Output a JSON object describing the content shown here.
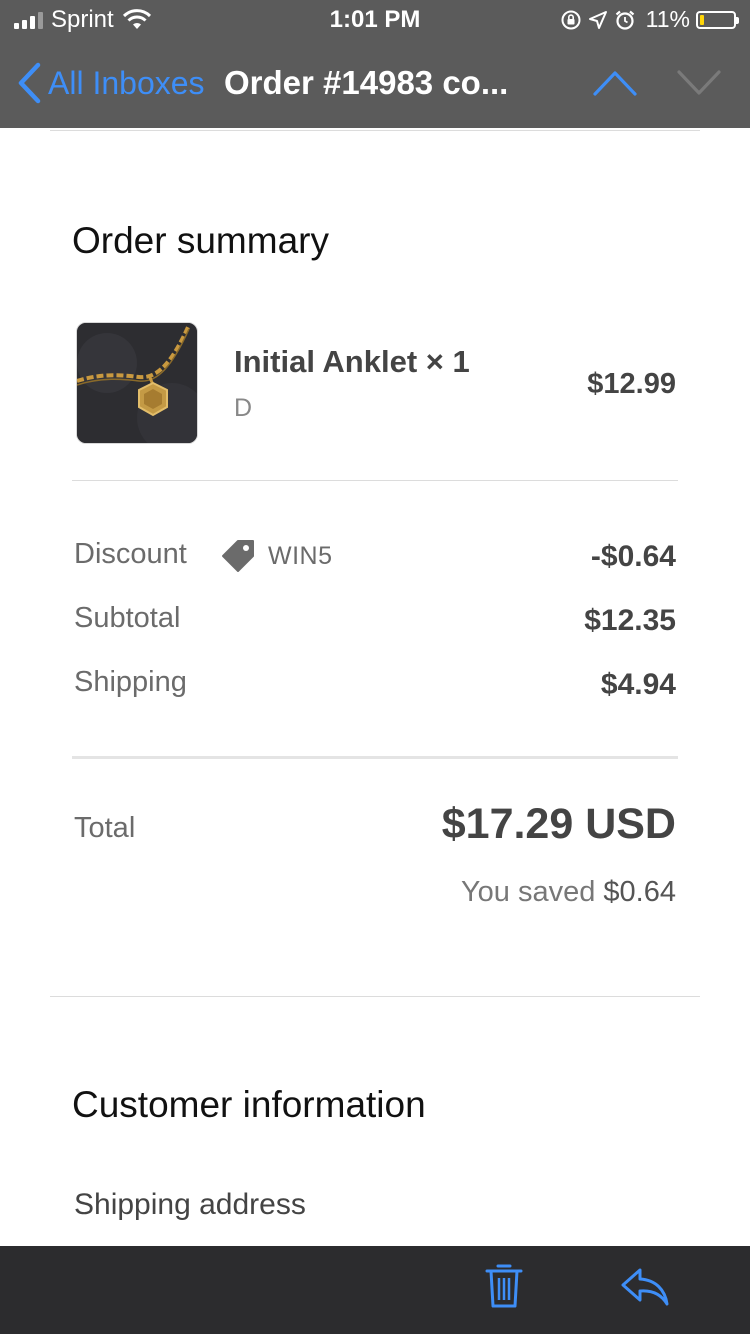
{
  "status_bar": {
    "carrier": "Sprint",
    "time": "1:01 PM",
    "battery_percent": "11%",
    "battery_level": 0.11,
    "icons": [
      "signal-icon",
      "wifi-icon",
      "orientation-lock-icon",
      "location-icon",
      "alarm-icon",
      "battery-icon"
    ]
  },
  "nav": {
    "back_label": "All Inboxes",
    "title": "Order #14983 co...",
    "icons": [
      "chevron-left-icon",
      "chevron-up-icon",
      "chevron-down-icon"
    ]
  },
  "order_summary": {
    "heading": "Order summary",
    "item": {
      "name": "Initial Anklet × 1",
      "variant": "D",
      "price": "$12.99"
    },
    "discount": {
      "label": "Discount",
      "code": "WIN5",
      "value": "-$0.64"
    },
    "subtotal": {
      "label": "Subtotal",
      "value": "$12.35"
    },
    "shipping": {
      "label": "Shipping",
      "value": "$4.94"
    },
    "total": {
      "label": "Total",
      "value": "$17.29 USD"
    },
    "saved": {
      "prefix": "You saved",
      "amount": "$0.64"
    }
  },
  "customer_info": {
    "heading": "Customer information",
    "shipping_address_label": "Shipping address"
  },
  "toolbar": {
    "icons": [
      "trash-icon",
      "reply-icon"
    ]
  },
  "colors": {
    "accent": "#3e8ef7",
    "header_bg": "#5b5b5b",
    "toolbar_bg": "#2c2c2e",
    "battery_low": "#ffd60a"
  }
}
